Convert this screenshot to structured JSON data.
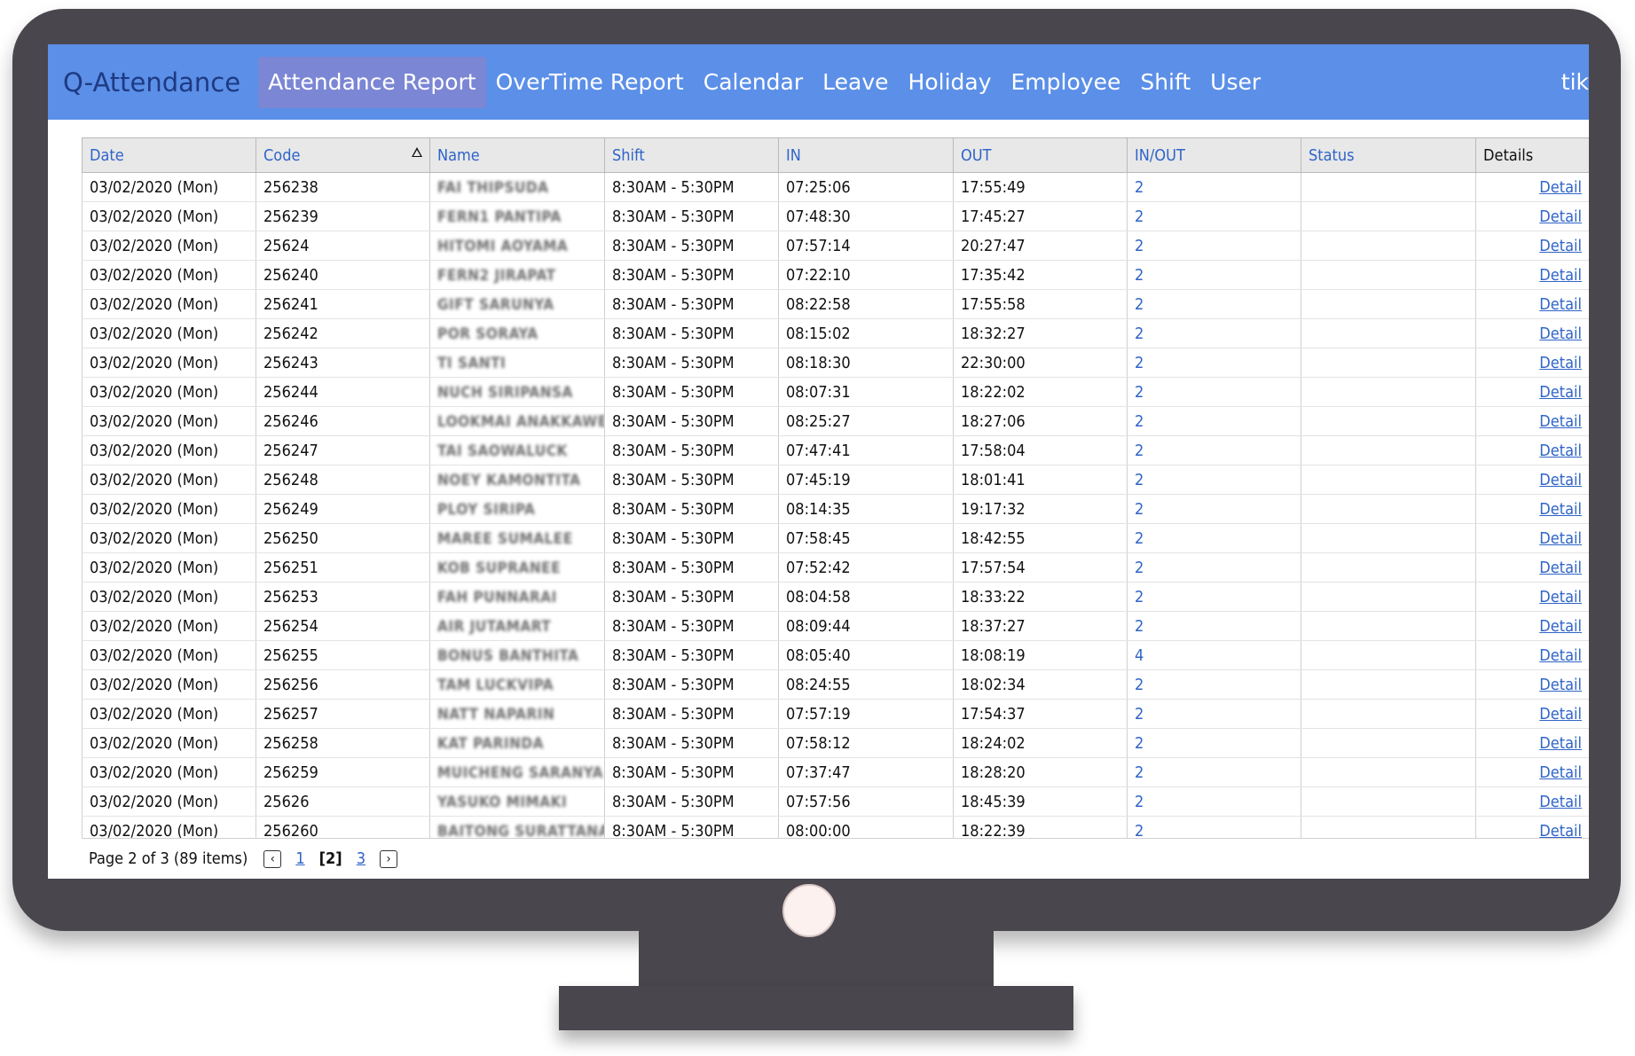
{
  "nav": {
    "brand": "Q-Attendance",
    "items": [
      "Attendance Report",
      "OverTime Report",
      "Calendar",
      "Leave",
      "Holiday",
      "Employee",
      "Shift",
      "User"
    ],
    "active_index": 0,
    "user": "tik"
  },
  "grid": {
    "columns": [
      "Date",
      "Code",
      "Name",
      "Shift",
      "IN",
      "OUT",
      "IN/OUT",
      "Status",
      "Details"
    ],
    "sorted_column": "Code",
    "rows": [
      {
        "date": "03/02/2020 (Mon)",
        "code": "256238",
        "name": "FAI THIPSUDA",
        "shift": "8:30AM - 5:30PM",
        "in": "07:25:06",
        "out": "17:55:49",
        "inout": "2",
        "status": "",
        "detail": "Detail"
      },
      {
        "date": "03/02/2020 (Mon)",
        "code": "256239",
        "name": "FERN1 PANTIPA",
        "shift": "8:30AM - 5:30PM",
        "in": "07:48:30",
        "out": "17:45:27",
        "inout": "2",
        "status": "",
        "detail": "Detail"
      },
      {
        "date": "03/02/2020 (Mon)",
        "code": "25624",
        "name": "HITOMI AOYAMA",
        "shift": "8:30AM - 5:30PM",
        "in": "07:57:14",
        "out": "20:27:47",
        "inout": "2",
        "status": "",
        "detail": "Detail"
      },
      {
        "date": "03/02/2020 (Mon)",
        "code": "256240",
        "name": "FERN2 JIRAPAT",
        "shift": "8:30AM - 5:30PM",
        "in": "07:22:10",
        "out": "17:35:42",
        "inout": "2",
        "status": "",
        "detail": "Detail"
      },
      {
        "date": "03/02/2020 (Mon)",
        "code": "256241",
        "name": "GIFT SARUNYA",
        "shift": "8:30AM - 5:30PM",
        "in": "08:22:58",
        "out": "17:55:58",
        "inout": "2",
        "status": "",
        "detail": "Detail"
      },
      {
        "date": "03/02/2020 (Mon)",
        "code": "256242",
        "name": "POR SORAYA",
        "shift": "8:30AM - 5:30PM",
        "in": "08:15:02",
        "out": "18:32:27",
        "inout": "2",
        "status": "",
        "detail": "Detail"
      },
      {
        "date": "03/02/2020 (Mon)",
        "code": "256243",
        "name": "TI SANTI",
        "shift": "8:30AM - 5:30PM",
        "in": "08:18:30",
        "out": "22:30:00",
        "inout": "2",
        "status": "",
        "detail": "Detail"
      },
      {
        "date": "03/02/2020 (Mon)",
        "code": "256244",
        "name": "NUCH SIRIPANSA",
        "shift": "8:30AM - 5:30PM",
        "in": "08:07:31",
        "out": "18:22:02",
        "inout": "2",
        "status": "",
        "detail": "Detail"
      },
      {
        "date": "03/02/2020 (Mon)",
        "code": "256246",
        "name": "LOOKMAI ANAKKAWEE",
        "shift": "8:30AM - 5:30PM",
        "in": "08:25:27",
        "out": "18:27:06",
        "inout": "2",
        "status": "",
        "detail": "Detail"
      },
      {
        "date": "03/02/2020 (Mon)",
        "code": "256247",
        "name": "TAI SAOWALUCK",
        "shift": "8:30AM - 5:30PM",
        "in": "07:47:41",
        "out": "17:58:04",
        "inout": "2",
        "status": "",
        "detail": "Detail"
      },
      {
        "date": "03/02/2020 (Mon)",
        "code": "256248",
        "name": "NOEY KAMONTITA",
        "shift": "8:30AM - 5:30PM",
        "in": "07:45:19",
        "out": "18:01:41",
        "inout": "2",
        "status": "",
        "detail": "Detail"
      },
      {
        "date": "03/02/2020 (Mon)",
        "code": "256249",
        "name": "PLOY SIRIPA",
        "shift": "8:30AM - 5:30PM",
        "in": "08:14:35",
        "out": "19:17:32",
        "inout": "2",
        "status": "",
        "detail": "Detail"
      },
      {
        "date": "03/02/2020 (Mon)",
        "code": "256250",
        "name": "MAREE SUMALEE",
        "shift": "8:30AM - 5:30PM",
        "in": "07:58:45",
        "out": "18:42:55",
        "inout": "2",
        "status": "",
        "detail": "Detail"
      },
      {
        "date": "03/02/2020 (Mon)",
        "code": "256251",
        "name": "KOB SUPRANEE",
        "shift": "8:30AM - 5:30PM",
        "in": "07:52:42",
        "out": "17:57:54",
        "inout": "2",
        "status": "",
        "detail": "Detail"
      },
      {
        "date": "03/02/2020 (Mon)",
        "code": "256253",
        "name": "FAH PUNNARAI",
        "shift": "8:30AM - 5:30PM",
        "in": "08:04:58",
        "out": "18:33:22",
        "inout": "2",
        "status": "",
        "detail": "Detail"
      },
      {
        "date": "03/02/2020 (Mon)",
        "code": "256254",
        "name": "AIR JUTAMART",
        "shift": "8:30AM - 5:30PM",
        "in": "08:09:44",
        "out": "18:37:27",
        "inout": "2",
        "status": "",
        "detail": "Detail"
      },
      {
        "date": "03/02/2020 (Mon)",
        "code": "256255",
        "name": "BONUS BANTHITA",
        "shift": "8:30AM - 5:30PM",
        "in": "08:05:40",
        "out": "18:08:19",
        "inout": "4",
        "status": "",
        "detail": "Detail"
      },
      {
        "date": "03/02/2020 (Mon)",
        "code": "256256",
        "name": "TAM LUCKVIPA",
        "shift": "8:30AM - 5:30PM",
        "in": "08:24:55",
        "out": "18:02:34",
        "inout": "2",
        "status": "",
        "detail": "Detail"
      },
      {
        "date": "03/02/2020 (Mon)",
        "code": "256257",
        "name": "NATT NAPARIN",
        "shift": "8:30AM - 5:30PM",
        "in": "07:57:19",
        "out": "17:54:37",
        "inout": "2",
        "status": "",
        "detail": "Detail"
      },
      {
        "date": "03/02/2020 (Mon)",
        "code": "256258",
        "name": "KAT PARINDA",
        "shift": "8:30AM - 5:30PM",
        "in": "07:58:12",
        "out": "18:24:02",
        "inout": "2",
        "status": "",
        "detail": "Detail"
      },
      {
        "date": "03/02/2020 (Mon)",
        "code": "256259",
        "name": "MUICHENG SARANYA",
        "shift": "8:30AM - 5:30PM",
        "in": "07:37:47",
        "out": "18:28:20",
        "inout": "2",
        "status": "",
        "detail": "Detail"
      },
      {
        "date": "03/02/2020 (Mon)",
        "code": "25626",
        "name": "YASUKO MIMAKI",
        "shift": "8:30AM - 5:30PM",
        "in": "07:57:56",
        "out": "18:45:39",
        "inout": "2",
        "status": "",
        "detail": "Detail"
      },
      {
        "date": "03/02/2020 (Mon)",
        "code": "256260",
        "name": "BAITONG SURATTANA",
        "shift": "8:30AM - 5:30PM",
        "in": "08:00:00",
        "out": "18:22:39",
        "inout": "2",
        "status": "",
        "detail": "Detail"
      }
    ]
  },
  "pager": {
    "info": "Page 2 of 3 (89 items)",
    "prev_icon": "chevron-left-icon",
    "next_icon": "chevron-right-icon",
    "pages": [
      "1",
      "[2]",
      "3"
    ],
    "current_index": 1
  },
  "colors": {
    "navbar": "#5b8fe8",
    "nav_active": "#7b86d4",
    "brand_text": "#1e3a82",
    "link": "#2f64c8",
    "monitor": "#4a464e"
  }
}
